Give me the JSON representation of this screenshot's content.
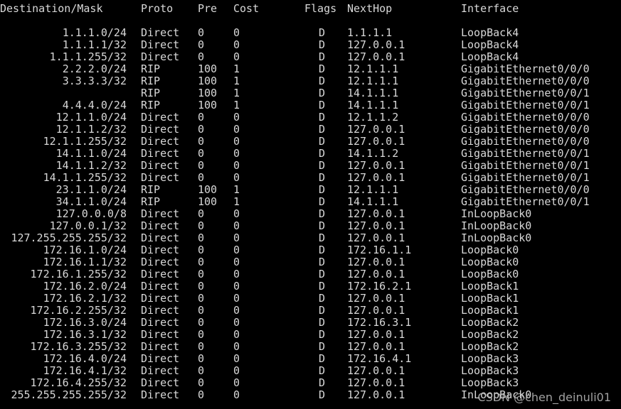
{
  "header": {
    "dest_mask": "Destination/Mask",
    "proto": "Proto",
    "pre": "Pre",
    "cost": "Cost",
    "flags": "Flags",
    "nexthop": "NextHop",
    "interface": "Interface"
  },
  "routes": [
    {
      "dest": "1.1.1.0/24",
      "proto": "Direct",
      "pre": "0",
      "cost": "0",
      "flags": "D",
      "nexthop": "1.1.1.1",
      "iface": "LoopBack4"
    },
    {
      "dest": "1.1.1.1/32",
      "proto": "Direct",
      "pre": "0",
      "cost": "0",
      "flags": "D",
      "nexthop": "127.0.0.1",
      "iface": "LoopBack4"
    },
    {
      "dest": "1.1.1.255/32",
      "proto": "Direct",
      "pre": "0",
      "cost": "0",
      "flags": "D",
      "nexthop": "127.0.0.1",
      "iface": "LoopBack4"
    },
    {
      "dest": "2.2.2.0/24",
      "proto": "RIP",
      "pre": "100",
      "cost": "1",
      "flags": "D",
      "nexthop": "12.1.1.1",
      "iface": "GigabitEthernet0/0/0"
    },
    {
      "dest": "3.3.3.3/32",
      "proto": "RIP",
      "pre": "100",
      "cost": "1",
      "flags": "D",
      "nexthop": "12.1.1.1",
      "iface": "GigabitEthernet0/0/0"
    },
    {
      "dest": "",
      "proto": "RIP",
      "pre": "100",
      "cost": "1",
      "flags": "D",
      "nexthop": "14.1.1.1",
      "iface": "GigabitEthernet0/0/1"
    },
    {
      "dest": "4.4.4.0/24",
      "proto": "RIP",
      "pre": "100",
      "cost": "1",
      "flags": "D",
      "nexthop": "14.1.1.1",
      "iface": "GigabitEthernet0/0/1"
    },
    {
      "dest": "12.1.1.0/24",
      "proto": "Direct",
      "pre": "0",
      "cost": "0",
      "flags": "D",
      "nexthop": "12.1.1.2",
      "iface": "GigabitEthernet0/0/0"
    },
    {
      "dest": "12.1.1.2/32",
      "proto": "Direct",
      "pre": "0",
      "cost": "0",
      "flags": "D",
      "nexthop": "127.0.0.1",
      "iface": "GigabitEthernet0/0/0"
    },
    {
      "dest": "12.1.1.255/32",
      "proto": "Direct",
      "pre": "0",
      "cost": "0",
      "flags": "D",
      "nexthop": "127.0.0.1",
      "iface": "GigabitEthernet0/0/0"
    },
    {
      "dest": "14.1.1.0/24",
      "proto": "Direct",
      "pre": "0",
      "cost": "0",
      "flags": "D",
      "nexthop": "14.1.1.2",
      "iface": "GigabitEthernet0/0/1"
    },
    {
      "dest": "14.1.1.2/32",
      "proto": "Direct",
      "pre": "0",
      "cost": "0",
      "flags": "D",
      "nexthop": "127.0.0.1",
      "iface": "GigabitEthernet0/0/1"
    },
    {
      "dest": "14.1.1.255/32",
      "proto": "Direct",
      "pre": "0",
      "cost": "0",
      "flags": "D",
      "nexthop": "127.0.0.1",
      "iface": "GigabitEthernet0/0/1"
    },
    {
      "dest": "23.1.1.0/24",
      "proto": "RIP",
      "pre": "100",
      "cost": "1",
      "flags": "D",
      "nexthop": "12.1.1.1",
      "iface": "GigabitEthernet0/0/0"
    },
    {
      "dest": "34.1.1.0/24",
      "proto": "RIP",
      "pre": "100",
      "cost": "1",
      "flags": "D",
      "nexthop": "14.1.1.1",
      "iface": "GigabitEthernet0/0/1"
    },
    {
      "dest": "127.0.0.0/8",
      "proto": "Direct",
      "pre": "0",
      "cost": "0",
      "flags": "D",
      "nexthop": "127.0.0.1",
      "iface": "InLoopBack0"
    },
    {
      "dest": "127.0.0.1/32",
      "proto": "Direct",
      "pre": "0",
      "cost": "0",
      "flags": "D",
      "nexthop": "127.0.0.1",
      "iface": "InLoopBack0"
    },
    {
      "dest": "127.255.255.255/32",
      "proto": "Direct",
      "pre": "0",
      "cost": "0",
      "flags": "D",
      "nexthop": "127.0.0.1",
      "iface": "InLoopBack0"
    },
    {
      "dest": "172.16.1.0/24",
      "proto": "Direct",
      "pre": "0",
      "cost": "0",
      "flags": "D",
      "nexthop": "172.16.1.1",
      "iface": "LoopBack0"
    },
    {
      "dest": "172.16.1.1/32",
      "proto": "Direct",
      "pre": "0",
      "cost": "0",
      "flags": "D",
      "nexthop": "127.0.0.1",
      "iface": "LoopBack0"
    },
    {
      "dest": "172.16.1.255/32",
      "proto": "Direct",
      "pre": "0",
      "cost": "0",
      "flags": "D",
      "nexthop": "127.0.0.1",
      "iface": "LoopBack0"
    },
    {
      "dest": "172.16.2.0/24",
      "proto": "Direct",
      "pre": "0",
      "cost": "0",
      "flags": "D",
      "nexthop": "172.16.2.1",
      "iface": "LoopBack1"
    },
    {
      "dest": "172.16.2.1/32",
      "proto": "Direct",
      "pre": "0",
      "cost": "0",
      "flags": "D",
      "nexthop": "127.0.0.1",
      "iface": "LoopBack1"
    },
    {
      "dest": "172.16.2.255/32",
      "proto": "Direct",
      "pre": "0",
      "cost": "0",
      "flags": "D",
      "nexthop": "127.0.0.1",
      "iface": "LoopBack1"
    },
    {
      "dest": "172.16.3.0/24",
      "proto": "Direct",
      "pre": "0",
      "cost": "0",
      "flags": "D",
      "nexthop": "172.16.3.1",
      "iface": "LoopBack2"
    },
    {
      "dest": "172.16.3.1/32",
      "proto": "Direct",
      "pre": "0",
      "cost": "0",
      "flags": "D",
      "nexthop": "127.0.0.1",
      "iface": "LoopBack2"
    },
    {
      "dest": "172.16.3.255/32",
      "proto": "Direct",
      "pre": "0",
      "cost": "0",
      "flags": "D",
      "nexthop": "127.0.0.1",
      "iface": "LoopBack2"
    },
    {
      "dest": "172.16.4.0/24",
      "proto": "Direct",
      "pre": "0",
      "cost": "0",
      "flags": "D",
      "nexthop": "172.16.4.1",
      "iface": "LoopBack3"
    },
    {
      "dest": "172.16.4.1/32",
      "proto": "Direct",
      "pre": "0",
      "cost": "0",
      "flags": "D",
      "nexthop": "127.0.0.1",
      "iface": "LoopBack3"
    },
    {
      "dest": "172.16.4.255/32",
      "proto": "Direct",
      "pre": "0",
      "cost": "0",
      "flags": "D",
      "nexthop": "127.0.0.1",
      "iface": "LoopBack3"
    },
    {
      "dest": "255.255.255.255/32",
      "proto": "Direct",
      "pre": "0",
      "cost": "0",
      "flags": "D",
      "nexthop": "127.0.0.1",
      "iface": "InLoopBack0"
    }
  ],
  "watermark": "CSDN @chen_deinuli01",
  "colors": {
    "background": "#000000",
    "text": "#d8d8d8"
  }
}
